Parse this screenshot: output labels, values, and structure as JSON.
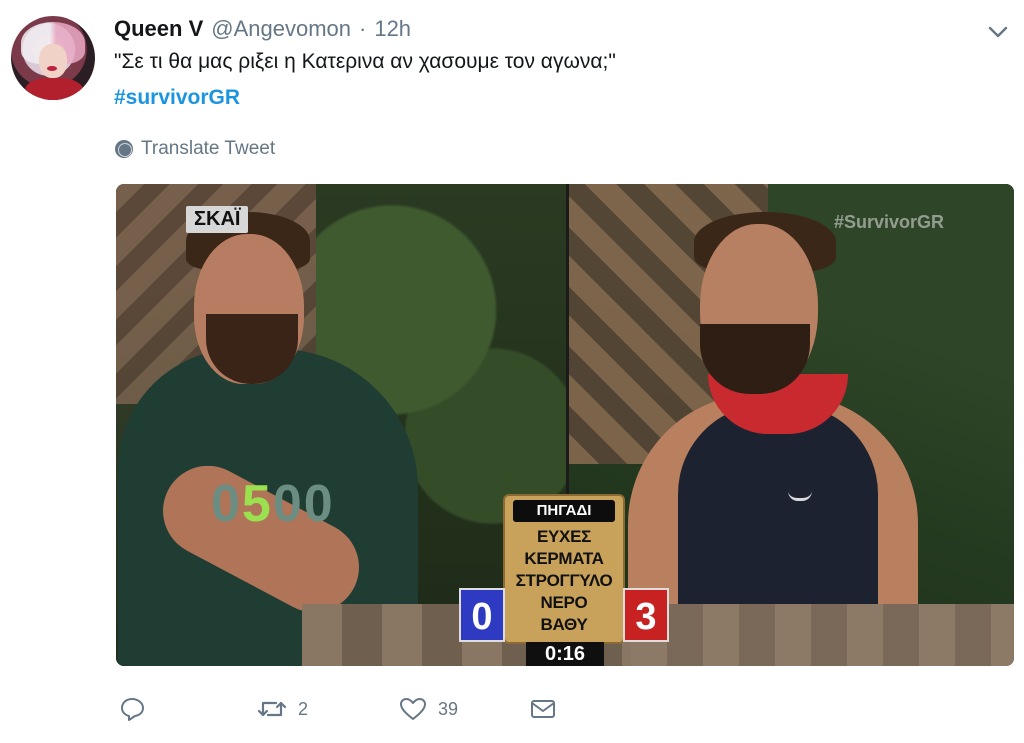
{
  "tweet": {
    "author_name": "Queen V",
    "handle": "@Angevomon",
    "time": "12h",
    "text": "\"Σε τι θα μας ριξει η Κατερινα αν χασουμε τον αγωνα;\"",
    "hashtag": "#survivorGR",
    "translate_label": "Translate Tweet"
  },
  "media": {
    "channel_logo": "ΣΚΑΪ",
    "watermark": "#SurvivorGR",
    "shirt_number": {
      "prefix": "0",
      "highlight": "5",
      "suffix": "00"
    },
    "scoreboard": {
      "title": "ΠΗΓΑΔΙ",
      "words": [
        "ΕΥΧΕΣ",
        "ΚΕΡΜΑΤΑ",
        "ΣΤΡΟΓΓΥΛΟ",
        "ΝΕΡΟ",
        "ΒΑΘΥ"
      ],
      "score_left": "0",
      "score_right": "3",
      "timer": "0:16"
    }
  },
  "actions": {
    "reply_icon": "reply-icon",
    "retweet_icon": "retweet-icon",
    "retweet_count": "2",
    "like_icon": "heart-icon",
    "like_count": "39",
    "dm_icon": "envelope-icon"
  },
  "colors": {
    "hashtag": "#1b95e0",
    "muted": "#657786",
    "text": "#14171a"
  }
}
